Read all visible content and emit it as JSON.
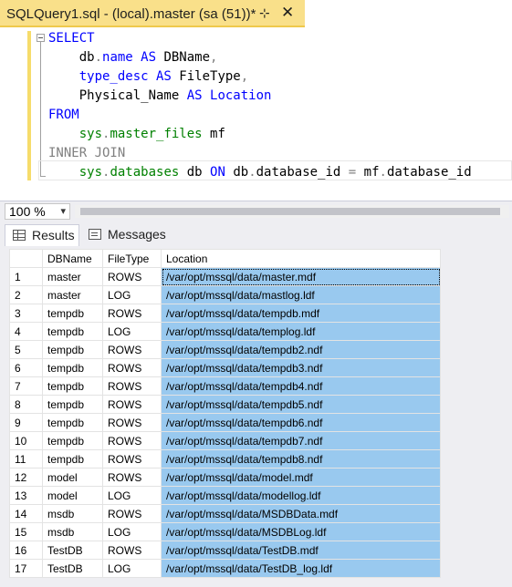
{
  "tab": {
    "title": "SQLQuery1.sql - (local).master (sa (51))*",
    "pin_icon": "⊹",
    "close_icon": "✕"
  },
  "editor": {
    "lines": [
      {
        "parts": [
          {
            "t": "SELECT",
            "c": "kw"
          }
        ]
      },
      {
        "parts": [
          {
            "t": "    db",
            "c": "id"
          },
          {
            "t": ".",
            "c": "gray"
          },
          {
            "t": "name",
            "c": "kw"
          },
          {
            "t": " AS ",
            "c": "kw"
          },
          {
            "t": "DBName",
            "c": "id"
          },
          {
            "t": ",",
            "c": "gray"
          }
        ]
      },
      {
        "parts": [
          {
            "t": "    type_desc",
            "c": "kw"
          },
          {
            "t": " AS ",
            "c": "kw"
          },
          {
            "t": "FileType",
            "c": "id"
          },
          {
            "t": ",",
            "c": "gray"
          }
        ]
      },
      {
        "parts": [
          {
            "t": "    Physical_Name ",
            "c": "id"
          },
          {
            "t": "AS",
            "c": "kw"
          },
          {
            "t": " ",
            "c": "id"
          },
          {
            "t": "Location",
            "c": "kw"
          }
        ]
      },
      {
        "parts": [
          {
            "t": "FROM",
            "c": "kw"
          }
        ]
      },
      {
        "parts": [
          {
            "t": "    sys",
            "c": "obj"
          },
          {
            "t": ".",
            "c": "gray"
          },
          {
            "t": "master_files",
            "c": "obj"
          },
          {
            "t": " mf",
            "c": "id"
          }
        ]
      },
      {
        "parts": [
          {
            "t": "INNER JOIN",
            "c": "gray"
          }
        ]
      },
      {
        "parts": [
          {
            "t": "    sys",
            "c": "obj"
          },
          {
            "t": ".",
            "c": "gray"
          },
          {
            "t": "databases",
            "c": "obj"
          },
          {
            "t": " db ",
            "c": "id"
          },
          {
            "t": "ON",
            "c": "kw"
          },
          {
            "t": " db",
            "c": "id"
          },
          {
            "t": ".",
            "c": "gray"
          },
          {
            "t": "database_id ",
            "c": "id"
          },
          {
            "t": "=",
            "c": "gray"
          },
          {
            "t": " mf",
            "c": "id"
          },
          {
            "t": ".",
            "c": "gray"
          },
          {
            "t": "database_id",
            "c": "id"
          }
        ]
      }
    ]
  },
  "zoom": {
    "value": "100 %",
    "arrow_icon": "▾"
  },
  "results_tabs": {
    "results_label": "Results",
    "messages_label": "Messages"
  },
  "grid": {
    "columns": [
      "",
      "DBName",
      "FileType",
      "Location"
    ],
    "rows": [
      [
        "1",
        "master",
        "ROWS",
        "/var/opt/mssql/data/master.mdf"
      ],
      [
        "2",
        "master",
        "LOG",
        "/var/opt/mssql/data/mastlog.ldf"
      ],
      [
        "3",
        "tempdb",
        "ROWS",
        "/var/opt/mssql/data/tempdb.mdf"
      ],
      [
        "4",
        "tempdb",
        "LOG",
        "/var/opt/mssql/data/templog.ldf"
      ],
      [
        "5",
        "tempdb",
        "ROWS",
        "/var/opt/mssql/data/tempdb2.ndf"
      ],
      [
        "6",
        "tempdb",
        "ROWS",
        "/var/opt/mssql/data/tempdb3.ndf"
      ],
      [
        "7",
        "tempdb",
        "ROWS",
        "/var/opt/mssql/data/tempdb4.ndf"
      ],
      [
        "8",
        "tempdb",
        "ROWS",
        "/var/opt/mssql/data/tempdb5.ndf"
      ],
      [
        "9",
        "tempdb",
        "ROWS",
        "/var/opt/mssql/data/tempdb6.ndf"
      ],
      [
        "10",
        "tempdb",
        "ROWS",
        "/var/opt/mssql/data/tempdb7.ndf"
      ],
      [
        "11",
        "tempdb",
        "ROWS",
        "/var/opt/mssql/data/tempdb8.ndf"
      ],
      [
        "12",
        "model",
        "ROWS",
        "/var/opt/mssql/data/model.mdf"
      ],
      [
        "13",
        "model",
        "LOG",
        "/var/opt/mssql/data/modellog.ldf"
      ],
      [
        "14",
        "msdb",
        "ROWS",
        "/var/opt/mssql/data/MSDBData.mdf"
      ],
      [
        "15",
        "msdb",
        "LOG",
        "/var/opt/mssql/data/MSDBLog.ldf"
      ],
      [
        "16",
        "TestDB",
        "ROWS",
        "/var/opt/mssql/data/TestDB.mdf"
      ],
      [
        "17",
        "TestDB",
        "LOG",
        "/var/opt/mssql/data/TestDB_log.ldf"
      ]
    ]
  },
  "colors": {
    "tab_active": "#f9e08a",
    "selection": "#99c9ef",
    "keyword": "#0000ff",
    "object": "#008000"
  }
}
